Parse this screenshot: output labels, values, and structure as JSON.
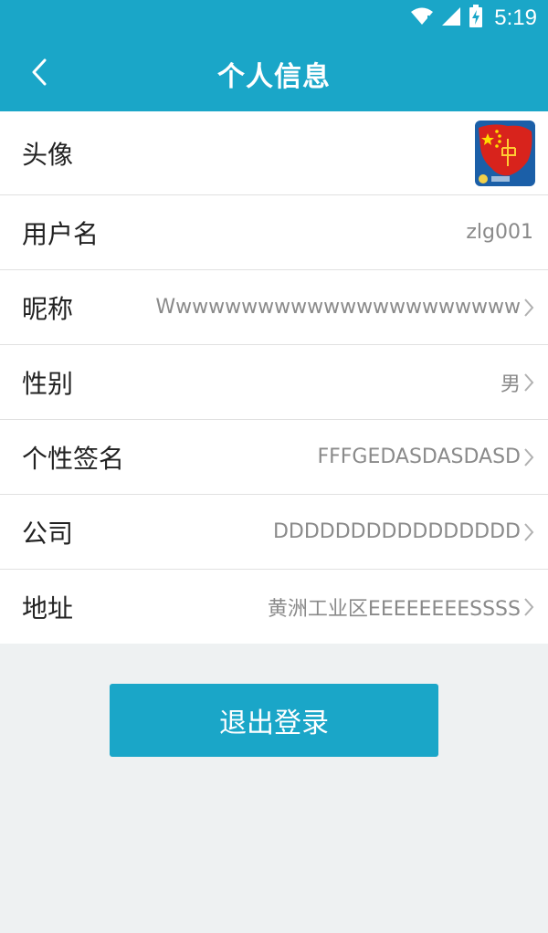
{
  "status_bar": {
    "time": "5:19",
    "icons": [
      "wifi-icon",
      "signal-icon",
      "battery-charging-icon"
    ]
  },
  "header": {
    "title": "个人信息",
    "back_icon": "chevron-left-icon"
  },
  "rows": [
    {
      "label": "头像",
      "value": "",
      "icon": "avatar-image"
    },
    {
      "label": "用户名",
      "value": "zlg001"
    },
    {
      "label": "昵称",
      "value": "Wwwwwwwwwwwwwwwwwwwwww"
    },
    {
      "label": "性别",
      "value": "男"
    },
    {
      "label": "个性签名",
      "value": "FFFGEDASDASDASD"
    },
    {
      "label": "公司",
      "value": "DDDDDDDDDDDDDDDD"
    },
    {
      "label": "地址",
      "value": "黄洲工业区EEEEEEEESSSS"
    }
  ],
  "logout": {
    "label": "退出登录"
  },
  "colors": {
    "primary": "#1aa6c8",
    "background": "#eef1f2",
    "value_text": "#8a8a8a"
  }
}
